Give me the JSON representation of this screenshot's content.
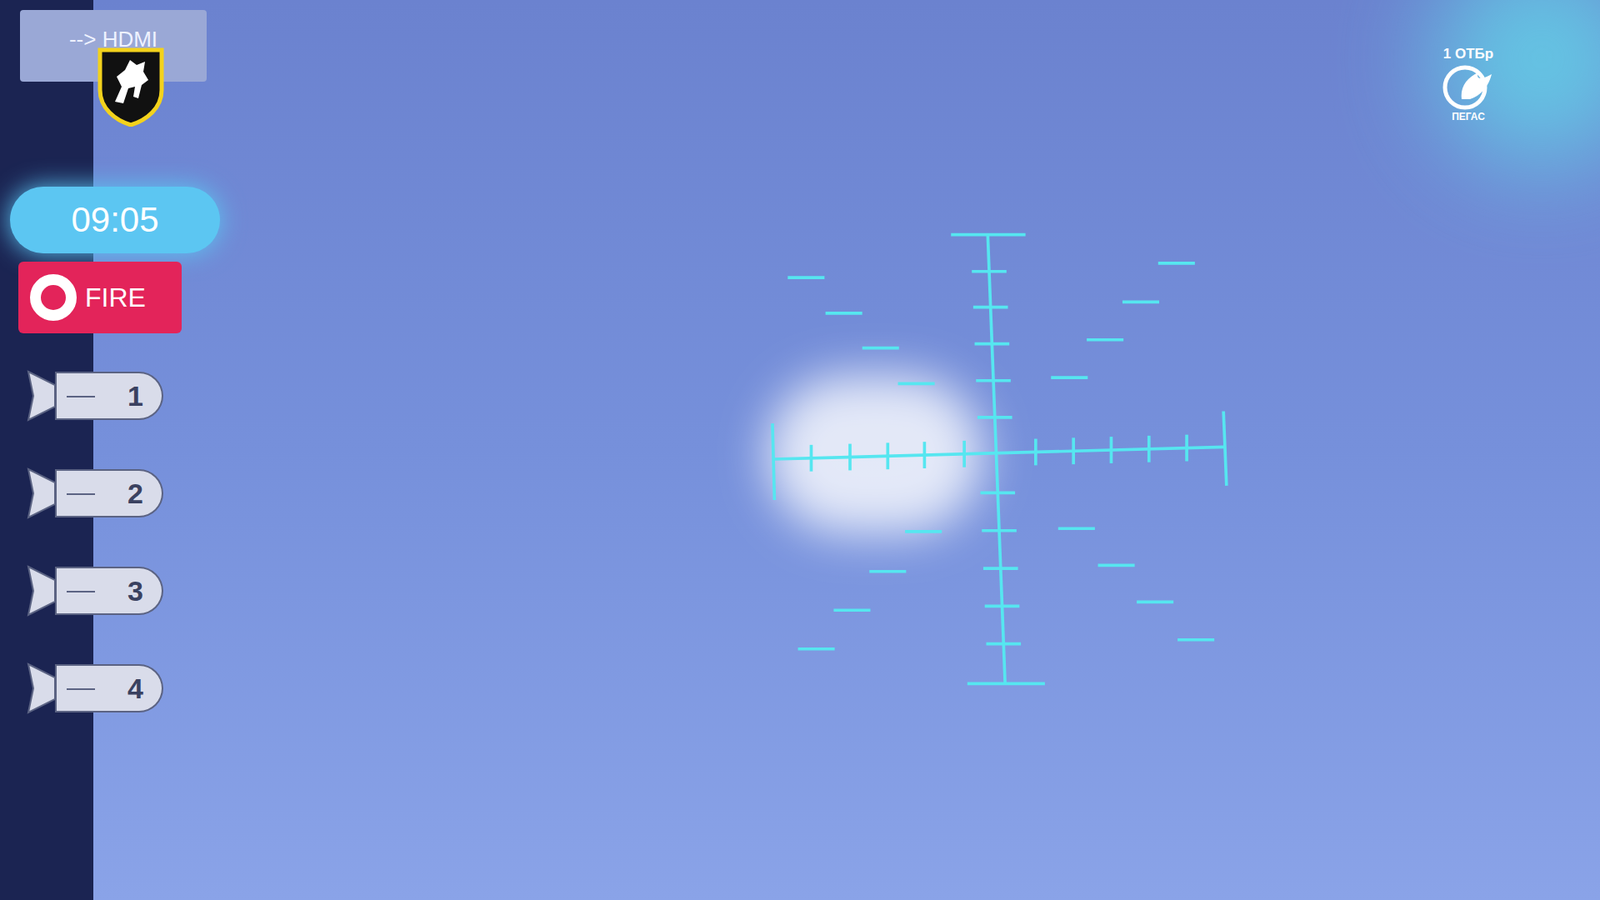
{
  "video_feed": {
    "source_label": "--> HDMI"
  },
  "timer": {
    "time": "09:05"
  },
  "fire_button": {
    "label": "FIRE"
  },
  "bombs": [
    {
      "label": "1"
    },
    {
      "label": "2"
    },
    {
      "label": "3"
    },
    {
      "label": "4"
    }
  ],
  "brand": {
    "unit": "1 ОТБр",
    "name": "ПЕГАС"
  }
}
